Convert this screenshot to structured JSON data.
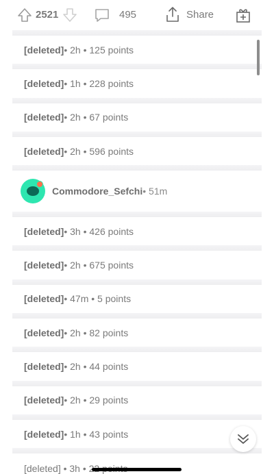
{
  "action_bar": {
    "score": "2521",
    "comments": "495",
    "share_label": "Share"
  },
  "comments": [
    {
      "author": "[deleted]",
      "meta": " • 2h • 125 points"
    },
    {
      "author": "[deleted]",
      "meta": " • 1h • 228 points"
    },
    {
      "author": "[deleted]",
      "meta": " • 2h • 67 points"
    },
    {
      "author": "[deleted]",
      "meta": " • 2h • 596 points"
    }
  ],
  "user_comment": {
    "author": "Commodore_Sefchi",
    "meta": " • 51m"
  },
  "comments_after": [
    {
      "author": "[deleted]",
      "meta": " • 3h • 426 points"
    },
    {
      "author": "[deleted]",
      "meta": " • 2h • 675 points"
    },
    {
      "author": "[deleted]",
      "meta": " • 47m • 5 points"
    },
    {
      "author": "[deleted]",
      "meta": " • 2h • 82 points"
    },
    {
      "author": "[deleted]",
      "meta": " • 2h • 44 points"
    },
    {
      "author": "[deleted]",
      "meta": " • 2h • 29 points"
    },
    {
      "author": "[deleted]",
      "meta": " • 1h • 43 points"
    }
  ],
  "partial_row": "[deleted] • 3h • 22 points",
  "colors": {
    "text": "#7a7a7a",
    "separator": "#f0f0f2",
    "avatar": "#2ee6b0"
  },
  "icons": {
    "upvote": "arrow-up-icon",
    "downvote": "arrow-down-icon",
    "comment": "speech-bubble-icon",
    "share": "share-icon",
    "award": "gift-icon",
    "jump": "double-chevron-down-icon"
  }
}
